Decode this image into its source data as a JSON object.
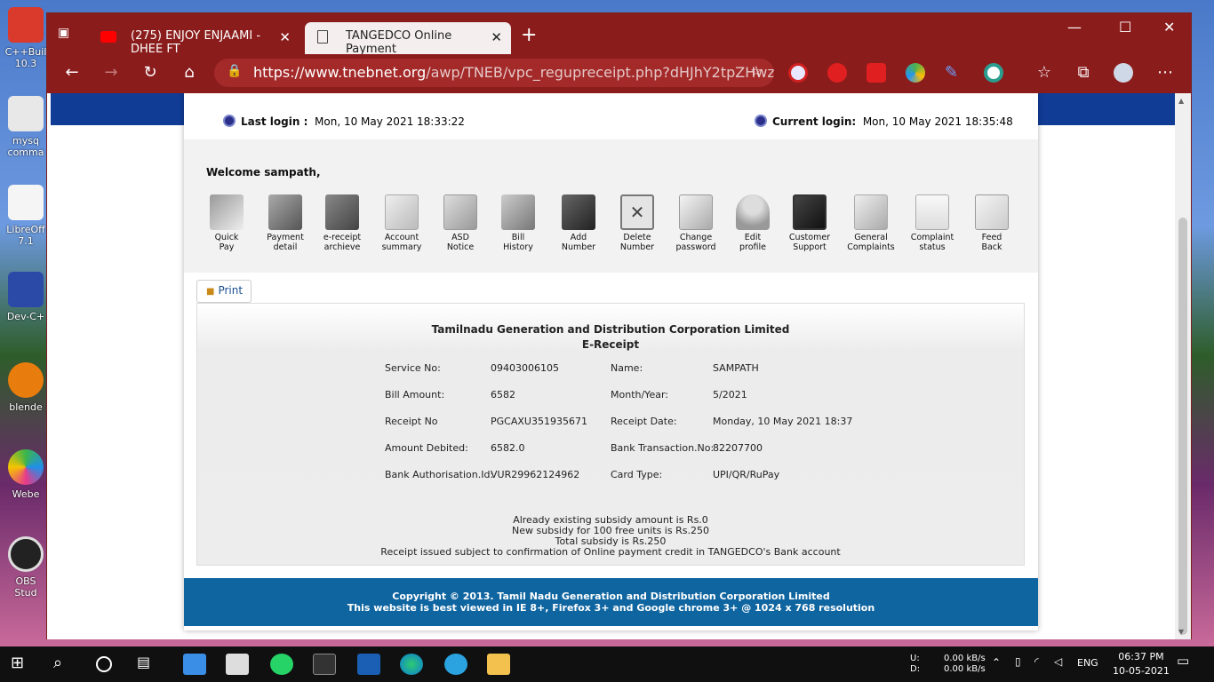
{
  "desktop": {
    "icons": [
      {
        "label": "C++Buil 10.3"
      },
      {
        "label": "mysq comma"
      },
      {
        "label": "LibreOff 7.1"
      },
      {
        "label": "Dev-C+"
      },
      {
        "label": "blende"
      },
      {
        "label": "Webe"
      },
      {
        "label": "OBS Stud"
      }
    ]
  },
  "browser": {
    "tabs": [
      {
        "title": "(275) ENJOY ENJAAMI - DHEE FT"
      },
      {
        "title": "TANGEDCO Online Payment"
      }
    ],
    "address": {
      "host": "https://www.tnebnet.org",
      "path": "/awp/TNEB/vpc_regupreceipt.php?dHJhY2tpZHwz..."
    }
  },
  "login": {
    "last_label": "Last login :",
    "last_value": "Mon, 10 May 2021 18:33:22",
    "current_label": "Current login:",
    "current_value": "Mon, 10 May 2021 18:35:48"
  },
  "welcome": "Welcome sampath,",
  "menu": [
    {
      "l1": "Quick",
      "l2": "Pay"
    },
    {
      "l1": "Payment",
      "l2": "detail"
    },
    {
      "l1": "e-receipt",
      "l2": "archieve"
    },
    {
      "l1": "Account",
      "l2": "summary"
    },
    {
      "l1": "ASD",
      "l2": "Notice"
    },
    {
      "l1": "Bill",
      "l2": "History"
    },
    {
      "l1": "Add",
      "l2": "Number"
    },
    {
      "l1": "Delete",
      "l2": "Number"
    },
    {
      "l1": "Change",
      "l2": "password"
    },
    {
      "l1": "Edit",
      "l2": "profile"
    },
    {
      "l1": "Customer",
      "l2": "Support"
    },
    {
      "l1": "General",
      "l2": "Complaints"
    },
    {
      "l1": "Complaint",
      "l2": "status"
    },
    {
      "l1": "Feed",
      "l2": "Back"
    }
  ],
  "print_label": "Print",
  "receipt": {
    "title": "Tamilnadu Generation and Distribution Corporation Limited",
    "subtitle": "E-Receipt",
    "rows": [
      {
        "k1": "Service No:",
        "v1": "09403006105",
        "k2": "Name:",
        "v2": "SAMPATH"
      },
      {
        "k1": "Bill Amount:",
        "v1": "6582",
        "k2": "Month/Year:",
        "v2": "5/2021"
      },
      {
        "k1": "Receipt No",
        "v1": "PGCAXU351935671",
        "k2": "Receipt Date:",
        "v2": "Monday, 10 May 2021 18:37"
      },
      {
        "k1": "Amount Debited:",
        "v1": "6582.0",
        "k2": "Bank Transaction.No:",
        "v2": "82207700"
      },
      {
        "k1": "Bank Authorisation.Id:",
        "v1": "VUR29962124962",
        "k2": "Card Type:",
        "v2": "UPI/QR/RuPay"
      }
    ],
    "notes": [
      "Already existing subsidy amount is Rs.0",
      "New subsidy for 100 free units is Rs.250",
      "Total subsidy is Rs.250",
      "Receipt issued subject to confirmation of Online payment credit in TANGEDCO's Bank account"
    ]
  },
  "footer": {
    "line1": "Copyright © 2013. Tamil Nadu Generation and Distribution Corporation Limited",
    "line2": "This website is best viewed in IE 8+, Firefox 3+ and Google chrome 3+ @ 1024 x 768 resolution"
  },
  "taskbar": {
    "net_up_label": "U:",
    "net_down_label": "D:",
    "net_up": "0.00 kB/s",
    "net_down": "0.00 kB/s",
    "lang": "ENG",
    "time": "06:37 PM",
    "date": "10-05-2021"
  }
}
